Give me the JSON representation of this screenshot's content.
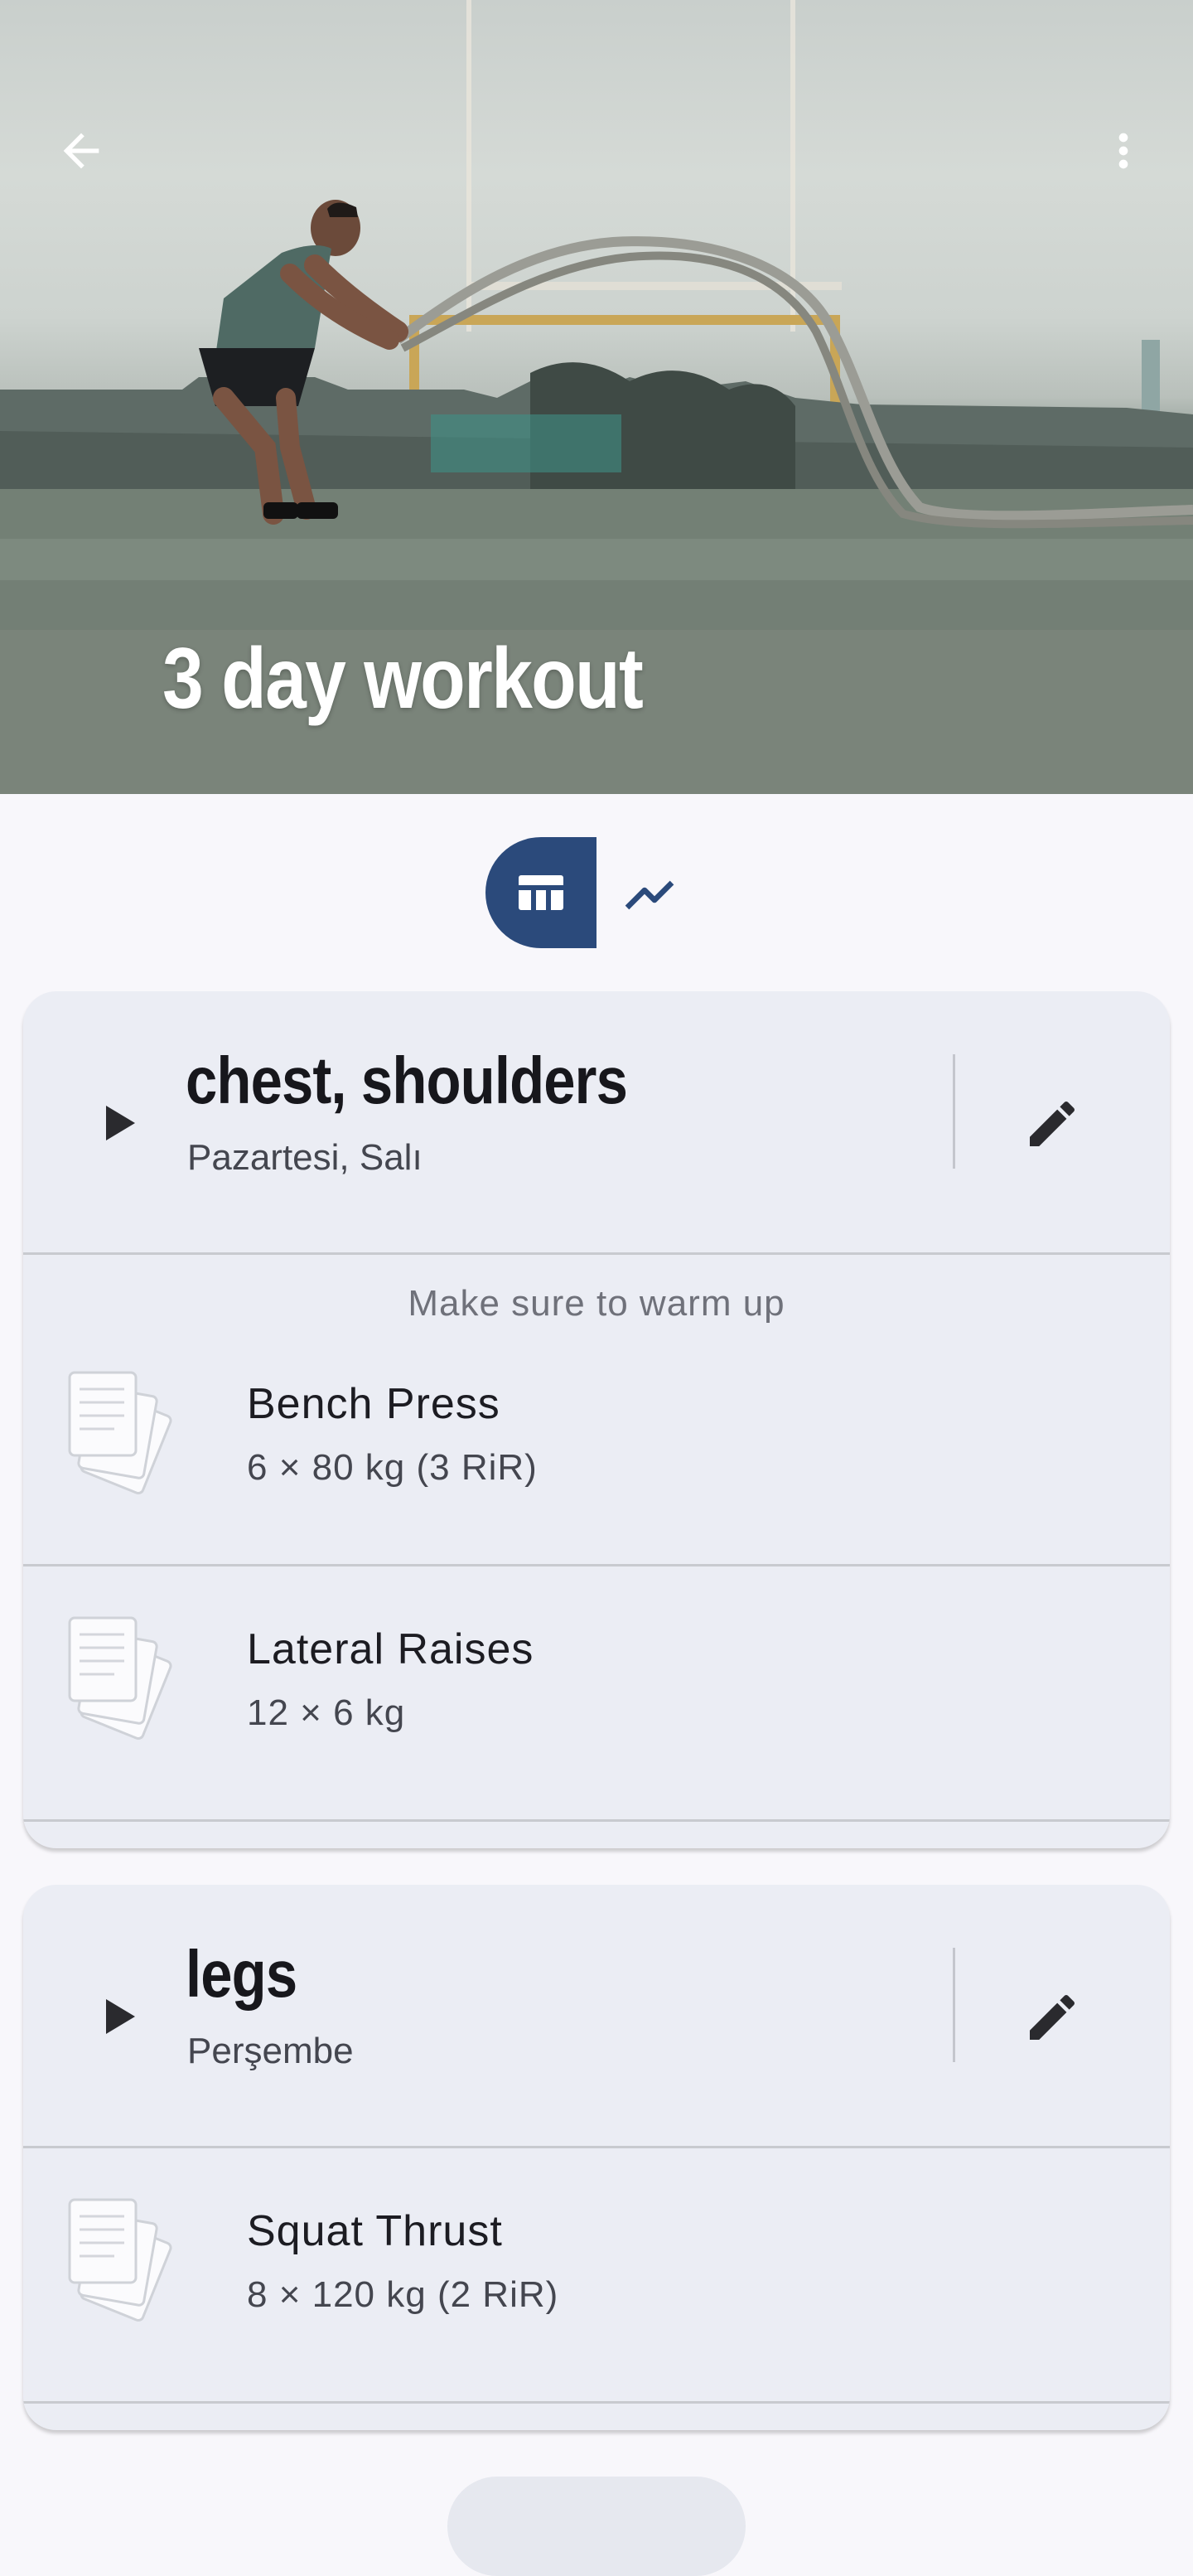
{
  "header": {
    "title": "3 day workout",
    "back_icon": "arrow-back-icon",
    "menu_icon": "more-vert-icon"
  },
  "view_toggle": {
    "active": "table",
    "tabs": [
      {
        "icon": "table-icon",
        "active": true
      },
      {
        "icon": "trending-up-icon",
        "active": false
      }
    ]
  },
  "days": [
    {
      "title": "chest, shoulders",
      "subtitle": "Pazartesi, Salı",
      "note": "Make sure to warm up",
      "exercises": [
        {
          "name": "Bench Press",
          "detail": "6 × 80 kg  (3 RiR)"
        },
        {
          "name": "Lateral Raises",
          "detail": "12 × 6 kg"
        }
      ]
    },
    {
      "title": "legs",
      "subtitle": "Perşembe",
      "exercises": [
        {
          "name": "Squat Thrust",
          "detail": "8 × 120 kg  (2 RiR)"
        }
      ]
    }
  ],
  "colors": {
    "primary": "#2b4a7b",
    "card_background": "#ebedf4",
    "page_background": "#f8f7fb"
  }
}
